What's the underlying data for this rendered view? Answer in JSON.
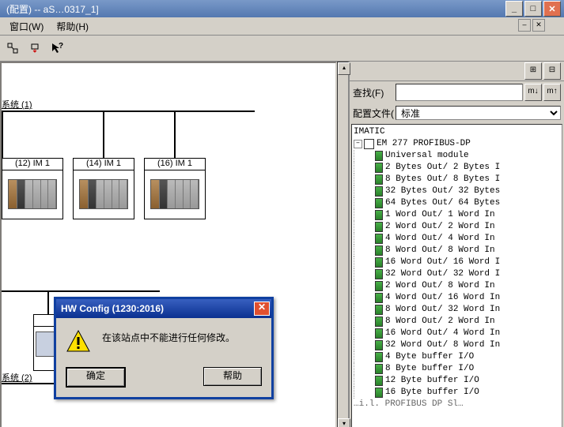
{
  "title": "(配置) -- aS…0317_1]",
  "menu": {
    "window": "窗口(W)",
    "help": "帮助(H)"
  },
  "toolbar": {
    "t1": "",
    "t2": "",
    "t3": ""
  },
  "system_labels": {
    "s1": "系统 (1)",
    "s2": "系统 (2)"
  },
  "nodes": [
    {
      "head": "(12) IM 1",
      "style": "rack"
    },
    {
      "head": "(14) IM 1",
      "style": "rack"
    },
    {
      "head": "(16) IM 1",
      "style": "rack"
    }
  ],
  "search": {
    "label": "查找(F)",
    "value": ""
  },
  "profile": {
    "label": "配置文件(",
    "value": "标准"
  },
  "tree_root": "IMATIC",
  "tree_device": "EM 277 PROFIBUS-DP",
  "tree_rows": [
    "Universal module",
    "2 Bytes Out/ 2 Bytes I",
    "8 Bytes Out/ 8 Bytes I",
    "32 Bytes Out/ 32 Bytes",
    "64 Bytes Out/ 64 Bytes",
    "1 Word Out/ 1 Word In",
    "2 Word Out/ 2 Word In",
    "4 Word Out/ 4 Word In",
    "8 Word Out/ 8 Word In",
    "16 Word Out/ 16 Word I",
    "32 Word Out/ 32 Word I",
    "2 Word Out/ 8 Word In",
    "4 Word Out/ 16 Word In",
    "8 Word Out/ 32 Word In",
    "8 Word Out/ 2 Word In",
    "16 Word Out/ 4 Word In",
    "32 Word Out/ 8 Word In",
    "4 Byte buffer I/O",
    "8 Byte buffer I/O",
    "12 Byte buffer I/O",
    "16 Byte buffer I/O"
  ],
  "tree_footer": "…i.l. PROFIBUS DP Sl…",
  "dialog": {
    "title": "HW Config (1230:2016)",
    "message": "在该站点中不能进行任何修改。",
    "ok": "确定",
    "help": "帮助"
  },
  "title_buttons": {
    "min": "_",
    "max": "□",
    "close": "✕"
  },
  "child_buttons": {
    "dash": "–",
    "close": "✕"
  }
}
